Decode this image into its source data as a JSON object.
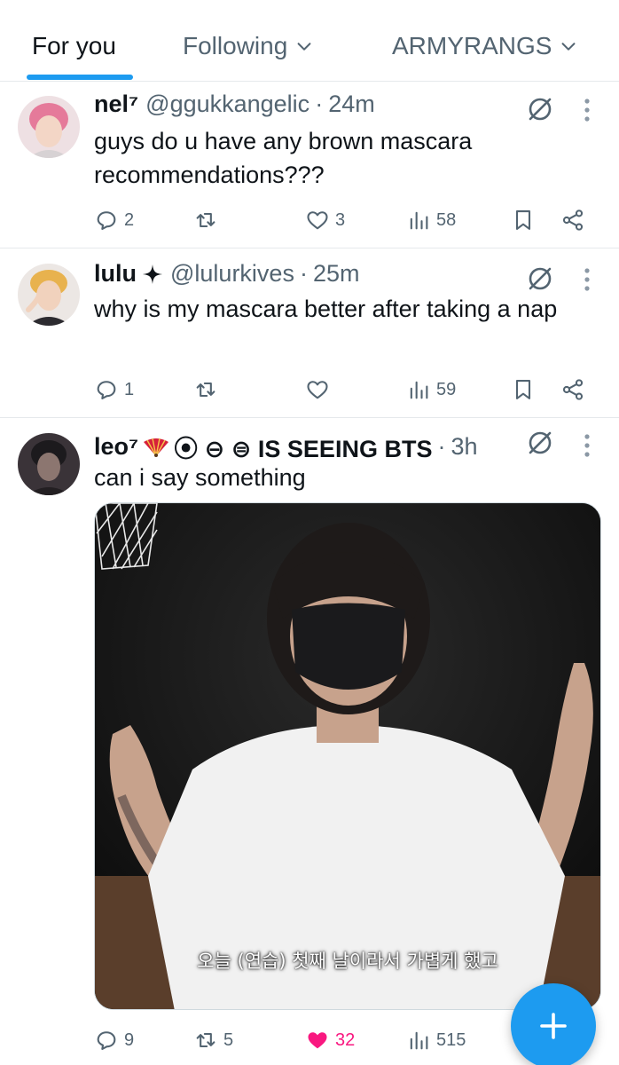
{
  "tabs": [
    {
      "label": "For you",
      "active": true
    },
    {
      "label": "Following",
      "has_dropdown": true
    },
    {
      "label": "ARMYRANGS",
      "has_dropdown": true
    }
  ],
  "posts": [
    {
      "display_name": "nel⁷",
      "handle": "@ggukkangelic",
      "separator": "·",
      "time": "24m",
      "text": "guys do u have any brown mascara recommendations???",
      "replies": "2",
      "reposts": "",
      "likes": "3",
      "views": "58",
      "liked": false
    },
    {
      "display_name": "lulu",
      "name_icon": "sparkle-icon",
      "handle": "@lulurkives",
      "separator": "·",
      "time": "25m",
      "text": "why is my mascara better after taking a nap",
      "replies": "1",
      "reposts": "",
      "likes": "",
      "views": "59",
      "liked": false
    },
    {
      "display_name": "leo⁷",
      "name_suffix": "⦿ ⊖ ⊜ IS SEEING BTS",
      "name_icon": "folding-fan-emoji",
      "handle": "",
      "separator": "·",
      "time": "3h",
      "text": "can i say something",
      "media_caption": "오늘 (연습) 첫째 날이라서 가볍게 했고",
      "replies": "9",
      "reposts": "5",
      "likes": "32",
      "views": "515",
      "liked": true
    }
  ],
  "colors": {
    "accent": "#1d9bf0",
    "like": "#f91880",
    "secondary_text": "#536471",
    "divider": "#e6e9ec"
  },
  "fab": {
    "icon": "plus-icon"
  }
}
